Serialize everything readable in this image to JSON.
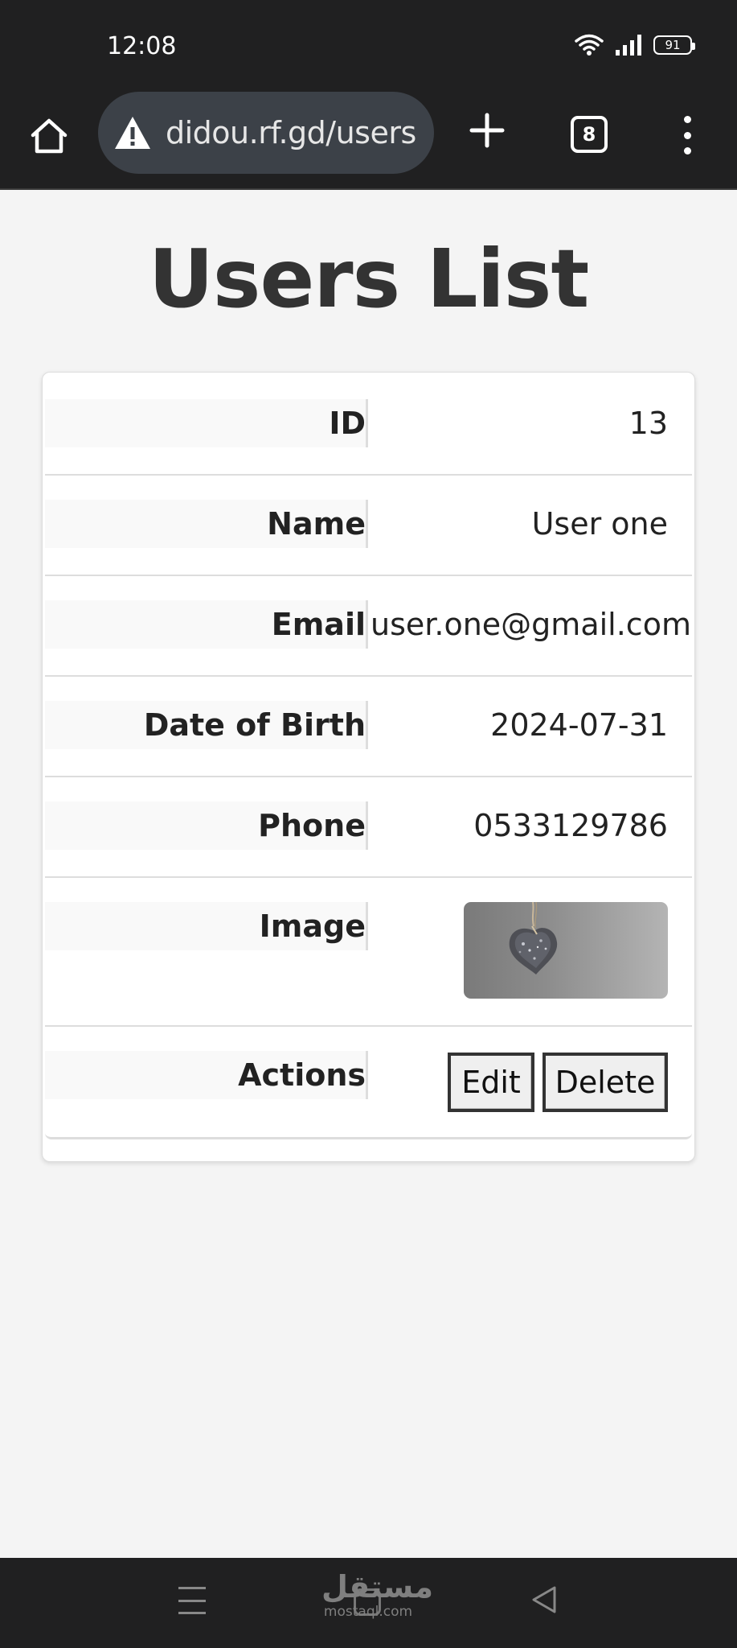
{
  "status": {
    "time": "12:08",
    "battery": "91"
  },
  "browser": {
    "url": "didou.rf.gd/users",
    "tab_count": "8"
  },
  "page": {
    "title": "Users List"
  },
  "user": {
    "rows": [
      {
        "label": "ID",
        "value": "13"
      },
      {
        "label": "Name",
        "value": "User one"
      },
      {
        "label": "Email",
        "value": "user.one@gmail.com"
      },
      {
        "label": "Date of Birth",
        "value": "2024-07-31"
      },
      {
        "label": "Phone",
        "value": "0533129786"
      },
      {
        "label": "Image",
        "image": "heart-stone-photo"
      },
      {
        "label": "Actions"
      }
    ],
    "actions": {
      "edit_label": "Edit",
      "delete_label": "Delete"
    }
  },
  "watermark": {
    "arabic": "مستقل",
    "latin": "mostaql.com"
  }
}
